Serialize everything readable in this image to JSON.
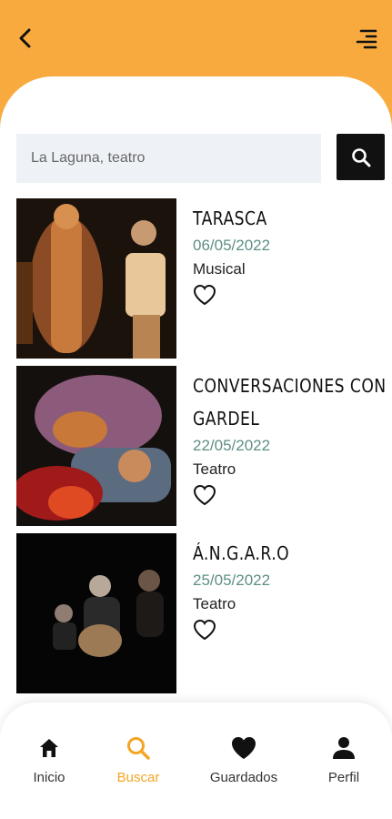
{
  "search": {
    "placeholder": "La Laguna, teatro",
    "value": ""
  },
  "events": [
    {
      "title": "TARASCA",
      "date": "06/05/2022",
      "category": "Musical"
    },
    {
      "title": "CONVERSACIONES CON",
      "title_line2": "GARDEL",
      "date": "22/05/2022",
      "category": "Teatro"
    },
    {
      "title": "Á.N.G.A.R.O",
      "date": "25/05/2022",
      "category": "Teatro"
    }
  ],
  "nav": {
    "home": "Inicio",
    "search": "Buscar",
    "saved": "Guardados",
    "profile": "Perfil"
  },
  "colors": {
    "accent": "#f8aa3f",
    "date": "#5e8f86",
    "active_nav": "#f4a524"
  },
  "icons": [
    "back-arrow-icon",
    "menu-icon",
    "search-icon",
    "heart-outline-icon",
    "home-icon",
    "heart-filled-icon",
    "person-icon"
  ]
}
